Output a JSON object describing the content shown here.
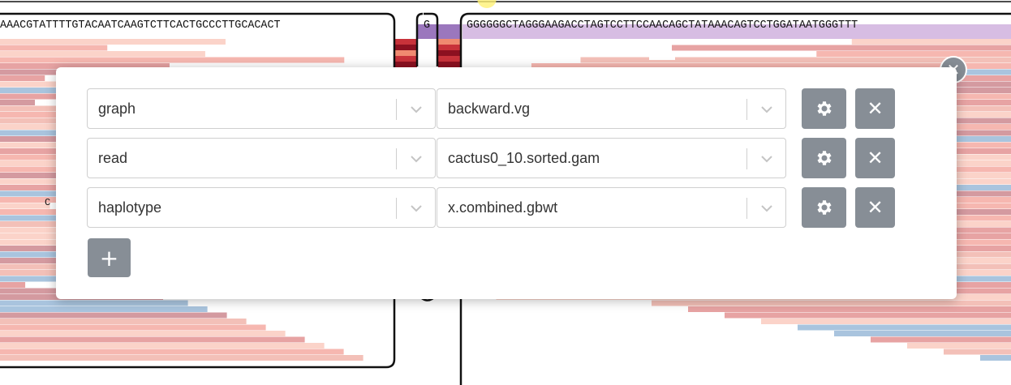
{
  "background": {
    "left_sequence": "AAACGTATTTTGTACAATCAAGTCTTCACTGCCCTTGCACACT",
    "middle_sequence": "G",
    "right_sequence": "GGGGGGCTAGGGAAGACCTAGTCCTTCCAACAGCTATAAACAGTCCTGGATAATGGGTTT",
    "stray_base": "C"
  },
  "colors": {
    "button": "#878e96",
    "read_pink": "#f6b7b0",
    "read_rose": "#d49aa0",
    "read_blue": "#a9c4de",
    "node_purple": "#9b77bd"
  },
  "modal": {
    "close_icon": "x-icon",
    "rows": [
      {
        "type": "graph",
        "file": "backward.vg"
      },
      {
        "type": "read",
        "file": "cactus0_10.sorted.gam"
      },
      {
        "type": "haplotype",
        "file": "x.combined.gbwt"
      }
    ],
    "settings_icon": "gear-icon",
    "remove_icon": "x-icon",
    "add_label": "+"
  }
}
